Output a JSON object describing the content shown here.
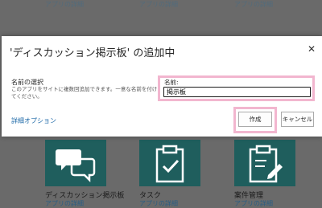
{
  "background": {
    "top_captions": [
      "アプリの詳細",
      "アプリの詳細",
      "アプリの詳細"
    ],
    "tiles": [
      {
        "title": "ディスカッション掲示板",
        "sub": "アプリの詳細",
        "icon": "chat-bubbles-icon"
      },
      {
        "title": "タスク",
        "sub": "アプリの詳細",
        "icon": "clipboard-check-icon"
      },
      {
        "title": "案件管理",
        "sub": "アプリの詳細",
        "icon": "clipboard-edit-icon"
      }
    ]
  },
  "dialog": {
    "title": "'ディスカッション掲示板' の追加中",
    "close_icon": "close-icon",
    "close_glyph": "✕",
    "section_label": "名前の選択",
    "section_desc": "このアプリをサイトに複数回追加できます。一意な名前を付けてください。",
    "name_label": "名前:",
    "name_value": "掲示板",
    "advanced_link": "詳細オプション",
    "create_label": "作成",
    "cancel_label": "キャンセル"
  },
  "colors": {
    "tile": "#1f5e5d",
    "highlight": "#f2b6cf",
    "link": "#1f6aa8"
  }
}
